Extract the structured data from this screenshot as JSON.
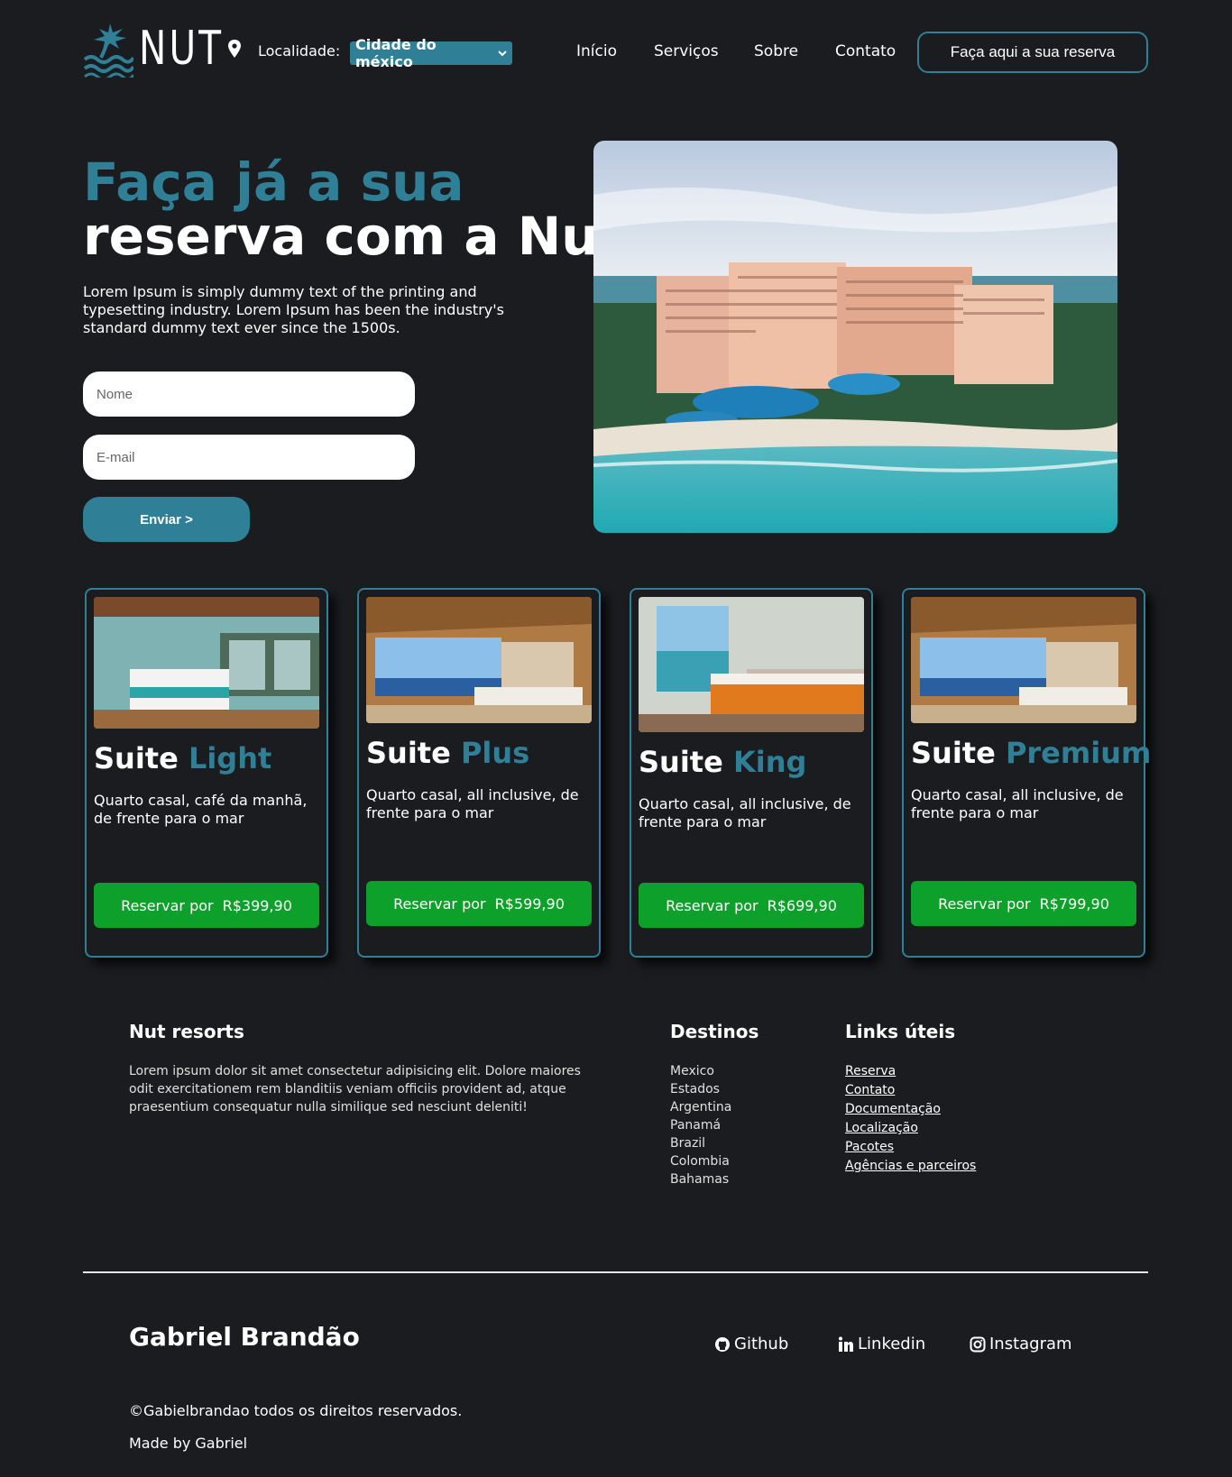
{
  "header": {
    "logo_text": "NUT",
    "location_label": "Localidade:",
    "location_selected": "Cidade do méxico",
    "nav": [
      "Início",
      "Serviços",
      "Sobre",
      "Contato"
    ],
    "cta": "Faça aqui a sua reserva"
  },
  "hero": {
    "title_line1": "Faça já a sua",
    "title_line2": "reserva com a Nut",
    "description": "Lorem Ipsum is simply dummy text of the printing and typesetting industry. Lorem Ipsum has been the industry's standard dummy text ever since the 1500s.",
    "name_placeholder": "Nome",
    "email_placeholder": "E-mail",
    "submit": "Enviar >"
  },
  "suites": [
    {
      "title_a": "Suite",
      "title_b": "Light",
      "description": "Quarto casal, café da manhã, de frente para o mar",
      "button_prefix": "Reservar por",
      "price": "R$399,90"
    },
    {
      "title_a": "Suite",
      "title_b": "Plus",
      "description": "Quarto casal, all inclusive, de frente para o mar",
      "button_prefix": "Reservar por",
      "price": "R$599,90"
    },
    {
      "title_a": "Suite",
      "title_b": "King",
      "description": "Quarto casal, all inclusive, de frente para o mar",
      "button_prefix": "Reservar por",
      "price": "R$699,90"
    },
    {
      "title_a": "Suite",
      "title_b": "Premium",
      "description": "Quarto casal, all inclusive, de frente para o mar",
      "button_prefix": "Reservar por",
      "price": "R$799,90"
    }
  ],
  "footer": {
    "about_title": "Nut resorts",
    "about_text": "Lorem ipsum dolor sit amet consectetur adipisicing elit. Dolore maiores odit exercitationem rem blanditiis veniam officiis provident ad, atque praesentium consequatur nulla similique sed nesciunt deleniti!",
    "destinations_title": "Destinos",
    "destinations": [
      "Mexico",
      "Estados",
      "Argentina",
      "Panamá",
      "Brazil",
      "Colombia",
      "Bahamas"
    ],
    "links_title": "Links úteis",
    "links": [
      "Reserva",
      "Contato",
      "Documentação",
      "Localização",
      "Pacotes",
      "Agências e parceiros"
    ],
    "author": "Gabriel Brandão",
    "social": {
      "github": "Github",
      "linkedin": "Linkedin",
      "instagram": "Instagram"
    },
    "copyright": "©Gabielbrandao todos os direitos reservados.",
    "made_by": "Made by Gabriel"
  },
  "colors": {
    "accent": "#2f7f97",
    "background": "#1a1c1f",
    "button_green": "#0da02a"
  }
}
